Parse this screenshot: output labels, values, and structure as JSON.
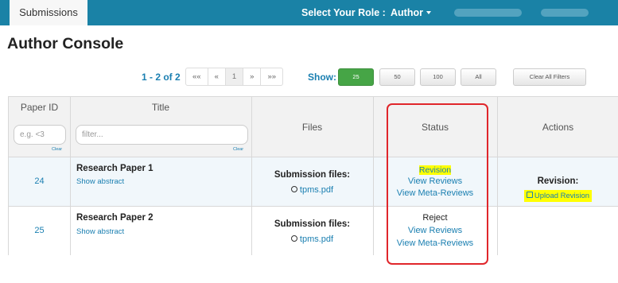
{
  "topbar": {
    "tab_label": "Submissions",
    "role_label": "Select Your Role :",
    "role_value": "Author"
  },
  "page_title": "Author Console",
  "pager": {
    "range": "1 - 2 of 2",
    "buttons": [
      "««",
      "«",
      "1",
      "»",
      "»»"
    ],
    "show_label": "Show:",
    "sizes": [
      "25",
      "50",
      "100",
      "All"
    ],
    "clear_filters": "Clear All Filters"
  },
  "table": {
    "headers": {
      "paper_id": "Paper ID",
      "title": "Title",
      "files": "Files",
      "status": "Status",
      "actions": "Actions"
    },
    "filters": {
      "id_placeholder": "e.g. <3",
      "title_placeholder": "filter...",
      "clear": "Clear"
    },
    "rows": [
      {
        "id": "24",
        "title": "Research Paper 1",
        "abstract": "Show abstract",
        "files_label": "Submission files:",
        "file": "tpms.pdf",
        "status": "Revision",
        "view_reviews": "View Reviews",
        "view_meta": "View Meta-Reviews",
        "action_label": "Revision:",
        "action_link": "Upload Revision"
      },
      {
        "id": "25",
        "title": "Research Paper 2",
        "abstract": "Show abstract",
        "files_label": "Submission files:",
        "file": "tpms.pdf",
        "status": "Reject",
        "view_reviews": "View Reviews",
        "view_meta": "View Meta-Reviews"
      }
    ]
  },
  "colors": {
    "topbar": "#1a82a6",
    "link": "#1a7fb1",
    "highlight": "#ffff00",
    "annotation": "#e0262b",
    "page_size_active": "#46a546"
  }
}
